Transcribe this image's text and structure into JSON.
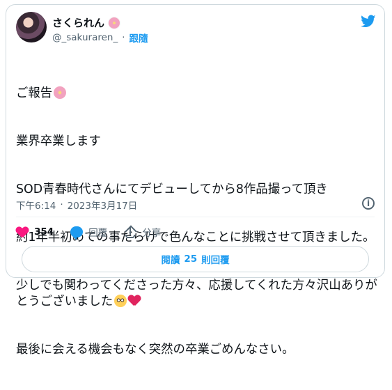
{
  "header": {
    "display_name": "さくられん",
    "handle": "@_sakuraren_",
    "separator": "·",
    "follow_label": "跟隨"
  },
  "tweet": {
    "lines": [
      "ご報告",
      "業界卒業します",
      "SOD青春時代さんにてデビューしてから8作品撮って頂き",
      "約1年半初めての事だらけで色んなことに挑戦させて頂きました。",
      "少しでも関わってくださった方々、応援してくれた方々沢山ありがとうございました",
      "最後に会える機会もなく突然の卒業ごめんなさい。"
    ]
  },
  "meta": {
    "time": "下午6:14",
    "separator": "·",
    "date": "2023年3月17日",
    "info_label": "i"
  },
  "actions": {
    "likes": "354",
    "reply_label": "回覆",
    "share_label": "分享"
  },
  "read_replies": {
    "label_prefix": "閱讀",
    "count": "25",
    "label_suffix": "則回覆"
  },
  "icons": {
    "twitter_bird": "twitter-bird-icon",
    "avatar": "avatar",
    "flower": "cherry-blossom-emoji",
    "pleading": "pleading-face-emoji",
    "heart_emoji": "red-heart-emoji",
    "like": "heart-icon",
    "reply": "reply-icon",
    "share": "share-icon",
    "info": "info-icon"
  },
  "colors": {
    "accent": "#1d9bf0",
    "text_primary": "#0f1419",
    "text_secondary": "#536471",
    "border": "#cfd9de",
    "like": "#f91880"
  }
}
